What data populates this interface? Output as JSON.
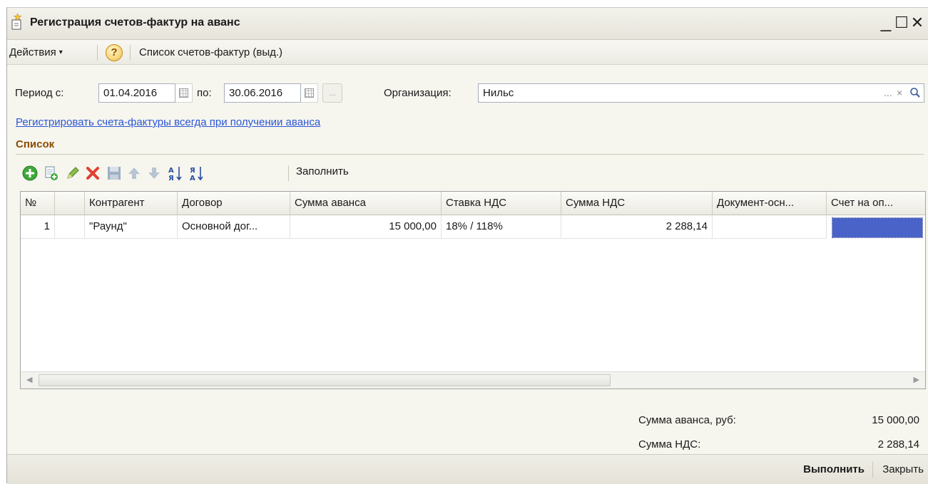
{
  "window": {
    "title": "Регистрация счетов-фактур на аванс",
    "minimize": "_",
    "maximize": "☐",
    "close": "✕"
  },
  "commandbar": {
    "actions_label": "Действия",
    "actions_arrow": "▾",
    "help_label": "?",
    "list_label": "Список счетов-фактур (выд.)"
  },
  "params": {
    "period_from_label": "Период с:",
    "period_from": "01.04.2016",
    "period_to_label": "по:",
    "period_to": "30.06.2016",
    "dots_label": "...",
    "org_label": "Организация:",
    "org_value": "Нильс",
    "org_select": "...",
    "org_clear": "×"
  },
  "link_text": "Регистрировать счета-фактуры всегда при получении аванса",
  "section_title": "Список",
  "toolbar": {
    "fill_label": "Заполнить",
    "icons": [
      "add-icon",
      "copy-icon",
      "edit-icon",
      "delete-icon",
      "save-icon",
      "move-up-icon",
      "move-down-icon",
      "sort-asc-icon",
      "sort-desc-icon"
    ]
  },
  "table": {
    "columns": [
      "№",
      "",
      "Контрагент",
      "Договор",
      "Сумма аванса",
      "Ставка НДС",
      "Сумма НДС",
      "Документ-осн...",
      "Счет на оп..."
    ],
    "rows": [
      {
        "n": "1",
        "flag": "",
        "counterparty": "\"Раунд\"",
        "contract": "Основной дог...",
        "advance_sum": "15 000,00",
        "vat_rate": "18% / 118%",
        "vat_sum": "2 288,14",
        "doc_basis": "",
        "invoice": ""
      }
    ]
  },
  "totals": {
    "advance_label": "Сумма аванса, руб:",
    "advance_value": "15 000,00",
    "vat_label": "Сумма НДС:",
    "vat_value": "2 288,14"
  },
  "buttons": {
    "execute": "Выполнить",
    "close": "Закрыть"
  },
  "colors": {
    "accent_link": "#2a56d4",
    "section_title": "#8c4c00",
    "selection": "#4a63c8"
  }
}
